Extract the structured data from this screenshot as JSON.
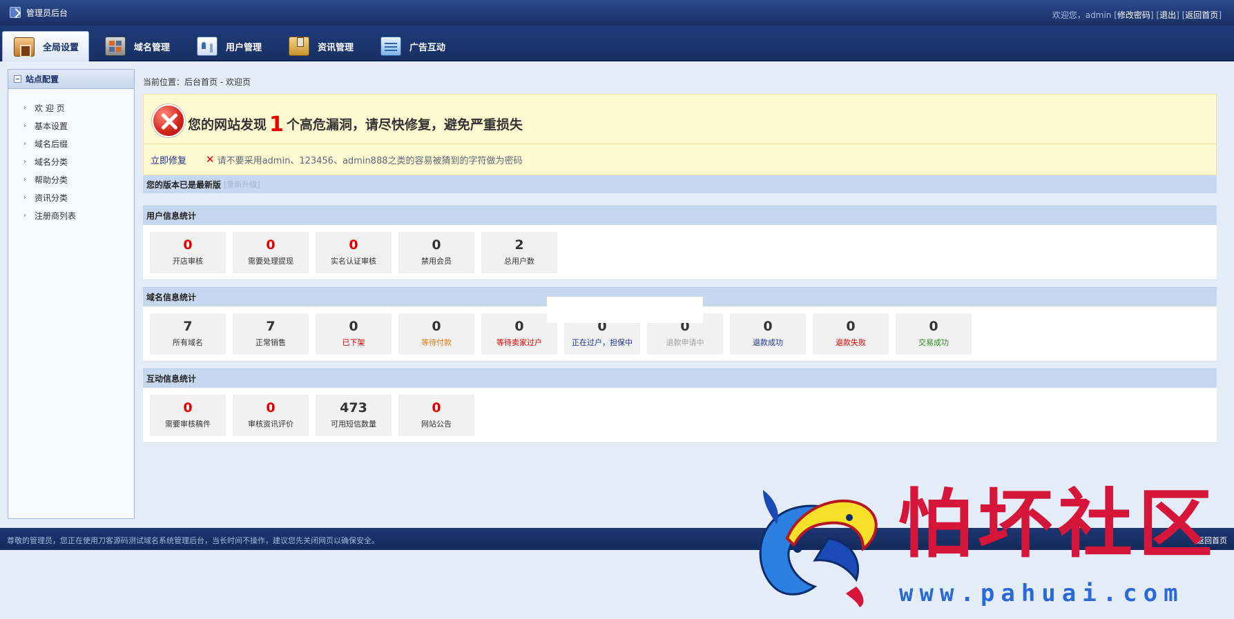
{
  "app": {
    "title": "管理员后台",
    "welcome": "欢迎您，admin",
    "links": {
      "change_password": "修改密码",
      "logout": "退出",
      "home": "返回首页"
    }
  },
  "nav": {
    "tabs": [
      {
        "label": "全局设置",
        "icon": "global-settings-icon",
        "active": true
      },
      {
        "label": "域名管理",
        "icon": "domain-grid-icon"
      },
      {
        "label": "用户管理",
        "icon": "user-card-icon"
      },
      {
        "label": "资讯管理",
        "icon": "news-bookmark-icon"
      },
      {
        "label": "广告互动",
        "icon": "ad-list-icon"
      }
    ]
  },
  "sidebar": {
    "title": "站点配置",
    "items": [
      {
        "label": "欢 迎 页"
      },
      {
        "label": "基本设置"
      },
      {
        "label": "域名后缀"
      },
      {
        "label": "域名分类"
      },
      {
        "label": "帮助分类"
      },
      {
        "label": "资讯分类"
      },
      {
        "label": "注册商列表"
      }
    ]
  },
  "breadcrumb": {
    "text": "当前位置：后台首页 - 欢迎页"
  },
  "alert": {
    "title_prefix": "您的网站发现",
    "count": "1",
    "title_suffix": "个高危漏洞，请尽快修复，避免严重损失",
    "fix_link": "立即修复",
    "warning": "请不要采用admin、123456、admin888之类的容易被猜到的字符做为密码",
    "colors": {
      "danger": "#e00000",
      "background": "#fff9d1"
    }
  },
  "version": {
    "text": "您的版本已是最新版",
    "upgrade": "[重新升级]"
  },
  "sections": {
    "user": {
      "title": "用户信息统计",
      "stats": [
        {
          "value": "0",
          "label": "开店审核",
          "value_color": "#e00000",
          "label_color": "#333333"
        },
        {
          "value": "0",
          "label": "需要处理提现",
          "value_color": "#e00000",
          "label_color": "#333333"
        },
        {
          "value": "0",
          "label": "实名认证审核",
          "value_color": "#e00000",
          "label_color": "#333333"
        },
        {
          "value": "0",
          "label": "禁用会员",
          "value_color": "#333333",
          "label_color": "#333333"
        },
        {
          "value": "2",
          "label": "总用户数",
          "value_color": "#333333",
          "label_color": "#333333"
        }
      ]
    },
    "domain": {
      "title": "域名信息统计",
      "stats": [
        {
          "value": "7",
          "label": "所有域名",
          "value_color": "#333333",
          "label_color": "#333333"
        },
        {
          "value": "7",
          "label": "正常销售",
          "value_color": "#333333",
          "label_color": "#333333"
        },
        {
          "value": "0",
          "label": "已下架",
          "value_color": "#333333",
          "label_color": "#e00000"
        },
        {
          "value": "0",
          "label": "等待付款",
          "value_color": "#333333",
          "label_color": "#e07a10"
        },
        {
          "value": "0",
          "label": "等待卖家过户",
          "value_color": "#333333",
          "label_color": "#e00000"
        },
        {
          "value": "0",
          "label": "正在过户，担保中",
          "value_color": "#333333",
          "label_color": "#1a2f8a"
        },
        {
          "value": "0",
          "label": "退款申请中",
          "value_color": "#333333",
          "label_color": "#a0a0a0"
        },
        {
          "value": "0",
          "label": "退款成功",
          "value_color": "#333333",
          "label_color": "#1a2f8a"
        },
        {
          "value": "0",
          "label": "退款失败",
          "value_color": "#333333",
          "label_color": "#e00000"
        },
        {
          "value": "0",
          "label": "交易成功",
          "value_color": "#333333",
          "label_color": "#2a8a1a"
        }
      ]
    },
    "interact": {
      "title": "互动信息统计",
      "stats": [
        {
          "value": "0",
          "label": "需要审核稿件",
          "value_color": "#e00000",
          "label_color": "#333333"
        },
        {
          "value": "0",
          "label": "审核资讯评价",
          "value_color": "#e00000",
          "label_color": "#333333"
        },
        {
          "value": "473",
          "label": "可用短信数量",
          "value_color": "#333333",
          "label_color": "#333333"
        },
        {
          "value": "0",
          "label": "网站公告",
          "value_color": "#e00000",
          "label_color": "#333333"
        }
      ]
    }
  },
  "footer": {
    "text": "尊敬的管理员，您正在使用刀客源码测试域名系统管理后台，当长时间不操作，建议您先关闭网页以确保安全。",
    "link": "返回首页"
  },
  "watermark": {
    "title": "怕坏社区",
    "url": "www.pahuai.com",
    "colors": {
      "title": "#d5163a",
      "url": "#2a6ad6"
    }
  }
}
